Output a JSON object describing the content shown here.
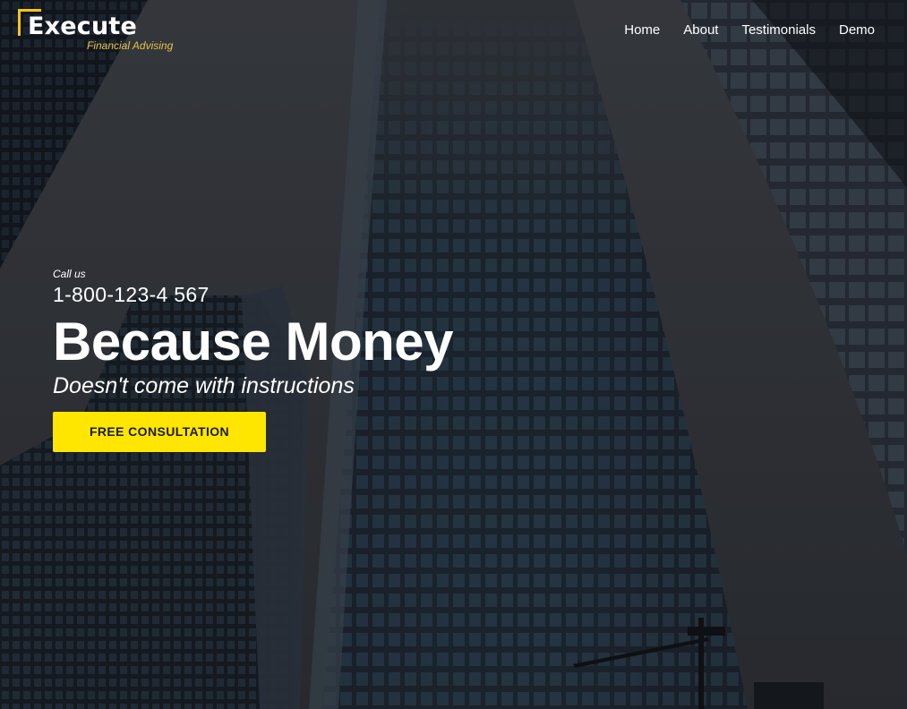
{
  "header": {
    "logo": {
      "title": "Execute",
      "subtitle": "Financial Advising"
    },
    "nav": [
      {
        "label": "Home"
      },
      {
        "label": "About"
      },
      {
        "label": "Testimonials"
      },
      {
        "label": "Demo"
      }
    ]
  },
  "hero": {
    "call_label": "Call us",
    "phone": "1-800-123-4 567",
    "headline": "Because Money",
    "subheadline": "Doesn't come with instructions",
    "cta_label": "FREE CONSULTATION"
  },
  "colors": {
    "accent": "#ffe600",
    "logo_accent": "#f5c518",
    "text": "#ffffff"
  }
}
